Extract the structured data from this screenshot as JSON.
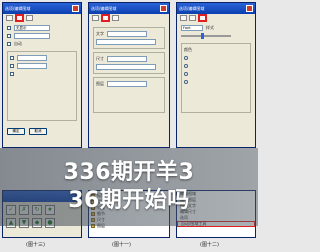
{
  "banner": {
    "line1": "336期开羊3",
    "line2": "36期开始吗"
  },
  "captions": {
    "left": "(图十三)",
    "middle": "(图十一)",
    "right": "(图十二)"
  },
  "windows": {
    "left": {
      "title": "选项/编辑图域",
      "field_value": "无显示",
      "side_label": "自动",
      "buttons": [
        "确定",
        "取消"
      ]
    },
    "middle": {
      "title": "选项/编辑图域",
      "labels": [
        "文字",
        "尺寸",
        "图层"
      ]
    },
    "right": {
      "title": "选项/编辑图域",
      "field_value": "Font",
      "labels": [
        "样式",
        "颜色"
      ]
    },
    "bottom_left": {
      "icons": [
        "✓",
        "✗",
        "↻",
        "★",
        "▲",
        "▼",
        "◆",
        "●"
      ]
    },
    "bottom_middle": {
      "items": [
        "标准",
        "组件",
        "对象",
        "细节",
        "尺寸",
        "图层"
      ]
    },
    "bottom_right": {
      "items": [
        "编辑图域",
        "编辑图层",
        "编辑文字",
        "编辑尺寸",
        "选项",
        "自动/图域工具"
      ],
      "highlight": "自动/图域工具"
    }
  },
  "colors": {
    "titlebar": "#0b3fb0",
    "highlight": "#e02020",
    "window_bg": "#ece9d8"
  }
}
